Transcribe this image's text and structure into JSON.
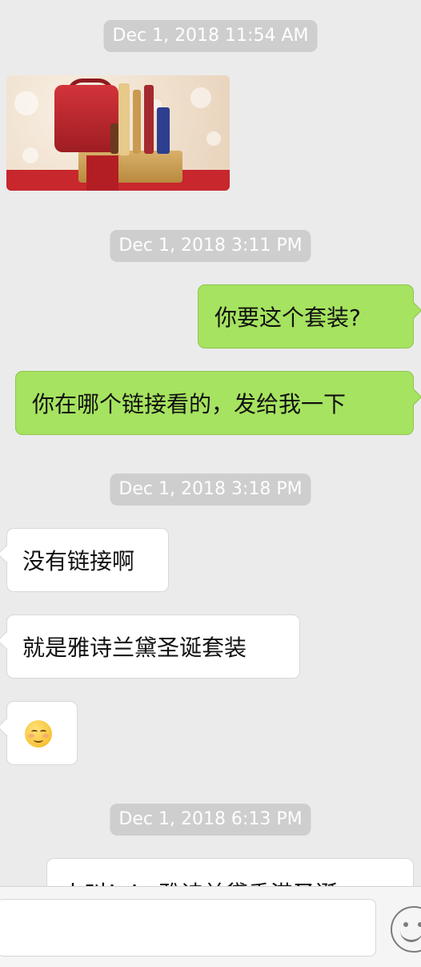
{
  "timestamps": [
    "Dec 1, 2018 11:54 AM",
    "Dec 1, 2018 3:11 PM",
    "Dec 1, 2018 3:18 PM",
    "Dec 1, 2018 6:13 PM"
  ],
  "messages": [
    {
      "direction": "out",
      "text": "你要这个套装?"
    },
    {
      "direction": "out",
      "text": "你在哪个链接看的，发给我一下"
    },
    {
      "direction": "in",
      "text": "没有链接啊"
    },
    {
      "direction": "in",
      "text": "就是雅诗兰黛圣诞套装"
    },
    {
      "direction": "in",
      "emoji": "blushing-smile-emoji"
    },
    {
      "direction": "in",
      "text": "火叫！！ 雅诗兰黛香港圣诞",
      "partially_hidden": true
    }
  ],
  "image_message": {
    "direction": "in",
    "content": "product-photo-gift-set"
  },
  "input_bar": {
    "icon": "emoji-face-icon"
  },
  "colors": {
    "background": "#ebebeb",
    "outgoing_bubble": "#a6e360",
    "incoming_bubble": "#ffffff",
    "timestamp_pill": "#cecece"
  }
}
